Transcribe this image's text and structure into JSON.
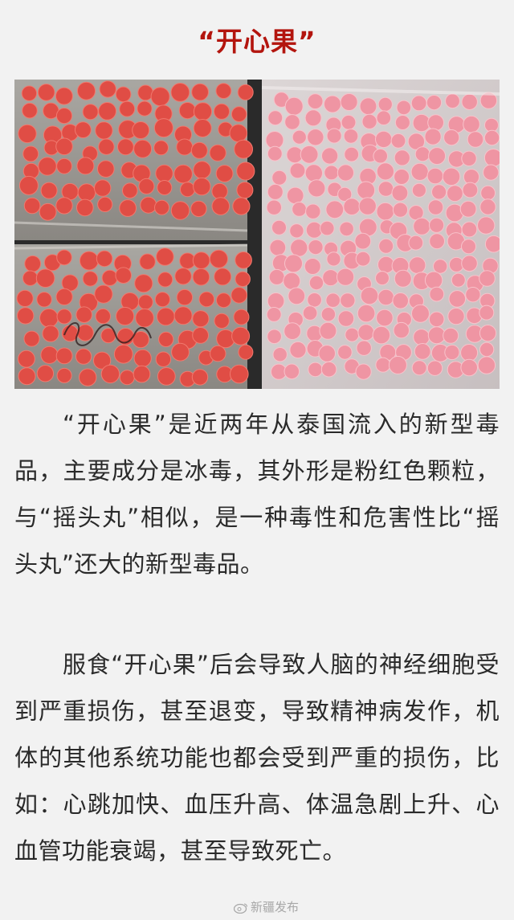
{
  "article": {
    "title": "“开心果”",
    "image_alt": "“开心果”",
    "paragraphs": [
      "“开心果”是近两年从泰国流入的新型毒品，主要成分是冰毒，其外形是粉红色颗粒，与“摇头丸”相似，是一种毒性和危害性比“摇头丸”还大的新型毒品。",
      "服食“开心果”后会导致人脑的神经细胞受到严重损伤，甚至退变，导致精神病发作，机体的其他系统功能也都会受到严重的损伤，比如：心跳加快、血压升高、体温急剧上升、心血管功能衰竭，甚至导致死亡。"
    ]
  },
  "watermark": {
    "text": "新疆发布",
    "icon": "weibo-logo-icon"
  },
  "colors": {
    "title": "#b3150e",
    "body_text": "#2a2a2a",
    "background": "#f2f2f2",
    "pill_red": "#e04d45",
    "pill_pink": "#ef95a3"
  }
}
